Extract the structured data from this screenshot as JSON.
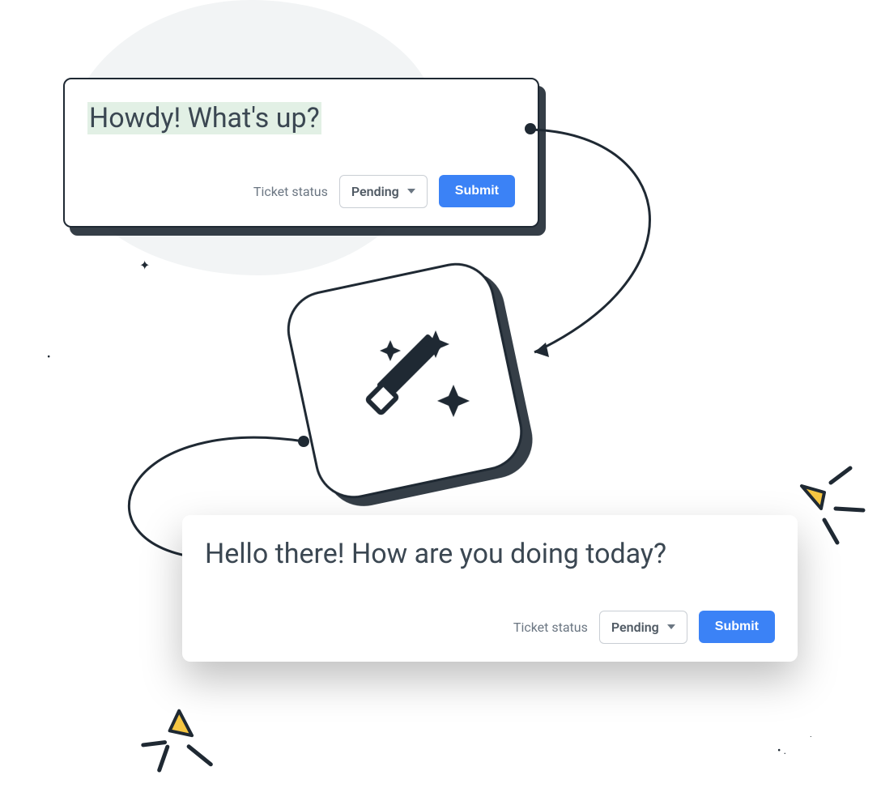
{
  "card1": {
    "text": "Howdy! What's up?",
    "ticket_label": "Ticket status",
    "dropdown_value": "Pending",
    "submit_label": "Submit"
  },
  "card2": {
    "text": "Hello there! How are you doing today?",
    "ticket_label": "Ticket status",
    "dropdown_value": "Pending",
    "submit_label": "Submit"
  }
}
